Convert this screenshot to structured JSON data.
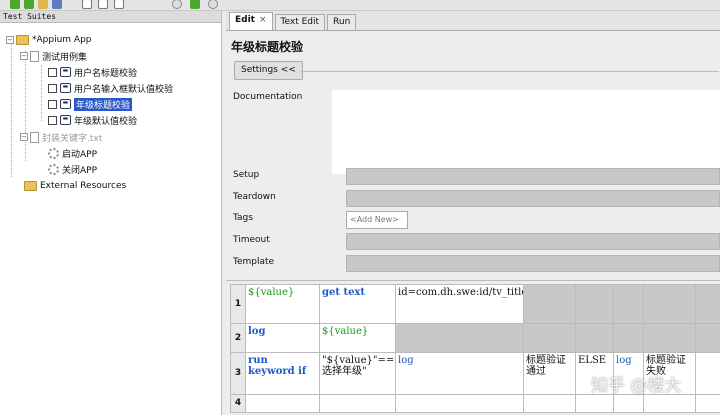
{
  "left_panel": {
    "header": "Test Suites",
    "tree": {
      "root": "*Appium App",
      "suite": "测试用例集",
      "cases": [
        "用户名标题校验",
        "用户名输入框默认值校验",
        "年级标题校验",
        "年级默认值校验"
      ],
      "resource": "封装关键字.txt",
      "keywords": [
        "启动APP",
        "关闭APP"
      ],
      "external": "External Resources"
    }
  },
  "tabs": [
    {
      "label": "Edit",
      "close": "×"
    },
    {
      "label": "Text Edit"
    },
    {
      "label": "Run"
    }
  ],
  "editor": {
    "title": "年级标题校验",
    "settings_button": "Settings <<",
    "fields": {
      "documentation": "Documentation",
      "setup": "Setup",
      "teardown": "Teardown",
      "tags": "Tags",
      "add_new": "<Add New>",
      "timeout": "Timeout",
      "template": "Template"
    },
    "grid": {
      "rows": [
        {
          "num": "1",
          "c1": "${value}",
          "c2": "get text",
          "c3": "id=com.dh.swe:id/tv_title"
        },
        {
          "num": "2",
          "c1": "log",
          "c2": "${value}"
        },
        {
          "num": "3",
          "c1": "run keyword if",
          "c2": "\"${value}\"==\"请选择年级\"",
          "c3": "log",
          "c4": "标题验证通过",
          "c5": "ELSE",
          "c6": "log",
          "c7": "标题验证失败"
        },
        {
          "num": "4"
        }
      ]
    }
  },
  "watermark": "知乎 @楼大",
  "colors": {
    "selection": "#2a58c8",
    "keyword": "#1a58c8",
    "variable": "#159615"
  }
}
